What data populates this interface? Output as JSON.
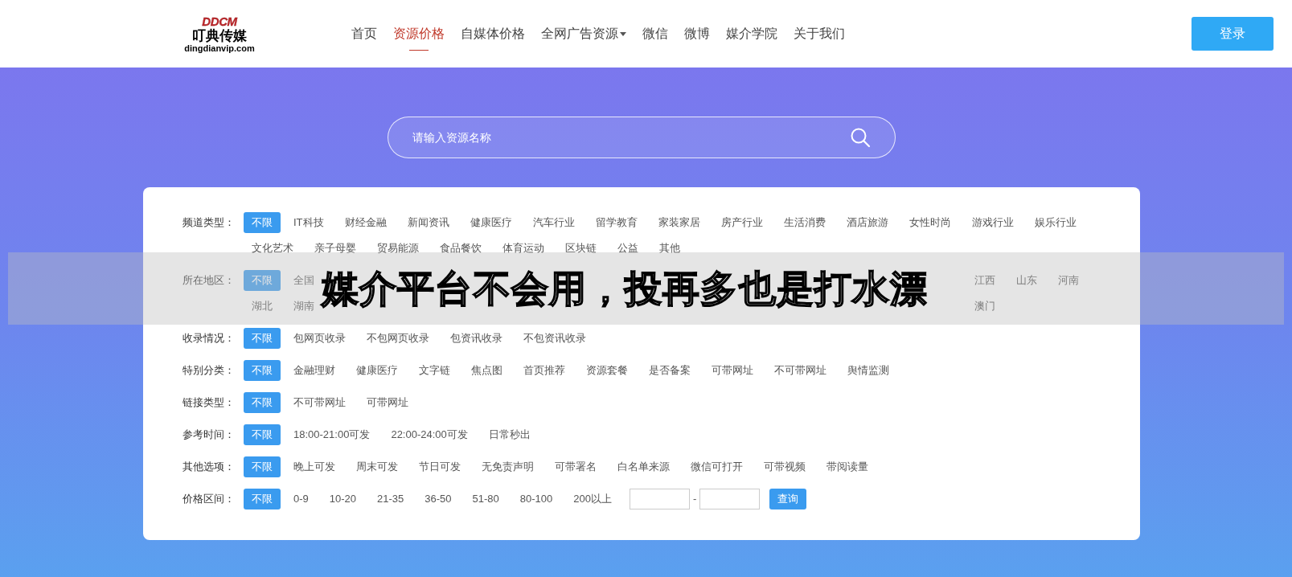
{
  "logo": {
    "name": "叮典传媒",
    "domain": "dingdianvip.com",
    "mark": "DDCM"
  },
  "nav": [
    {
      "label": "首页",
      "selected": false,
      "dropdown": false
    },
    {
      "label": "资源价格",
      "selected": true,
      "dropdown": false
    },
    {
      "label": "自媒体价格",
      "selected": false,
      "dropdown": false
    },
    {
      "label": "全网广告资源",
      "selected": false,
      "dropdown": true
    },
    {
      "label": "微信",
      "selected": false,
      "dropdown": false
    },
    {
      "label": "微博",
      "selected": false,
      "dropdown": false
    },
    {
      "label": "媒介学院",
      "selected": false,
      "dropdown": false
    },
    {
      "label": "关于我们",
      "selected": false,
      "dropdown": false
    }
  ],
  "login_button": "登录",
  "search": {
    "placeholder": "请输入资源名称"
  },
  "filters": [
    {
      "kind": "options",
      "label": "频道类型：",
      "options": [
        {
          "label": "不限",
          "selected": true
        },
        {
          "label": "IT科技",
          "selected": false
        },
        {
          "label": "财经金融",
          "selected": false
        },
        {
          "label": "新闻资讯",
          "selected": false
        },
        {
          "label": "健康医疗",
          "selected": false
        },
        {
          "label": "汽车行业",
          "selected": false
        },
        {
          "label": "留学教育",
          "selected": false
        },
        {
          "label": "家装家居",
          "selected": false
        },
        {
          "label": "房产行业",
          "selected": false
        },
        {
          "label": "生活消费",
          "selected": false
        },
        {
          "label": "酒店旅游",
          "selected": false
        },
        {
          "label": "女性时尚",
          "selected": false
        },
        {
          "label": "游戏行业",
          "selected": false
        },
        {
          "label": "娱乐行业",
          "selected": false
        },
        {
          "label": "文化艺术",
          "selected": false
        },
        {
          "label": "亲子母婴",
          "selected": false
        },
        {
          "label": "贸易能源",
          "selected": false
        },
        {
          "label": "食品餐饮",
          "selected": false
        },
        {
          "label": "体育运动",
          "selected": false
        },
        {
          "label": "区块链",
          "selected": false
        },
        {
          "label": "公益",
          "selected": false
        },
        {
          "label": "其他",
          "selected": false
        }
      ]
    },
    {
      "kind": "region",
      "label": "所在地区：",
      "lines": [
        {
          "left": [
            {
              "label": "不限",
              "selected": true
            },
            {
              "label": "全国",
              "selected": false
            }
          ],
          "right": [
            {
              "label": "江西",
              "selected": false
            },
            {
              "label": "山东",
              "selected": false
            },
            {
              "label": "河南",
              "selected": false
            }
          ]
        },
        {
          "left": [
            {
              "label": "湖北",
              "selected": false
            },
            {
              "label": "湖南",
              "selected": false
            }
          ],
          "right": [
            {
              "label": "澳门",
              "selected": false
            }
          ]
        }
      ]
    },
    {
      "kind": "options",
      "label": "收录情况：",
      "options": [
        {
          "label": "不限",
          "selected": true
        },
        {
          "label": "包网页收录",
          "selected": false
        },
        {
          "label": "不包网页收录",
          "selected": false
        },
        {
          "label": "包资讯收录",
          "selected": false
        },
        {
          "label": "不包资讯收录",
          "selected": false
        }
      ]
    },
    {
      "kind": "options",
      "label": "特别分类：",
      "options": [
        {
          "label": "不限",
          "selected": true
        },
        {
          "label": "金融理财",
          "selected": false
        },
        {
          "label": "健康医疗",
          "selected": false
        },
        {
          "label": "文字链",
          "selected": false
        },
        {
          "label": "焦点图",
          "selected": false
        },
        {
          "label": "首页推荐",
          "selected": false
        },
        {
          "label": "资源套餐",
          "selected": false
        },
        {
          "label": "是否备案",
          "selected": false
        },
        {
          "label": "可带网址",
          "selected": false
        },
        {
          "label": "不可带网址",
          "selected": false
        },
        {
          "label": "舆情监测",
          "selected": false
        }
      ]
    },
    {
      "kind": "options",
      "label": "链接类型：",
      "options": [
        {
          "label": "不限",
          "selected": true
        },
        {
          "label": "不可带网址",
          "selected": false
        },
        {
          "label": "可带网址",
          "selected": false
        }
      ]
    },
    {
      "kind": "options",
      "label": "参考时间：",
      "options": [
        {
          "label": "不限",
          "selected": true
        },
        {
          "label": "18:00-21:00可发",
          "selected": false
        },
        {
          "label": "22:00-24:00可发",
          "selected": false
        },
        {
          "label": "日常秒出",
          "selected": false
        }
      ]
    },
    {
      "kind": "options",
      "label": "其他选项：",
      "options": [
        {
          "label": "不限",
          "selected": true
        },
        {
          "label": "晚上可发",
          "selected": false
        },
        {
          "label": "周末可发",
          "selected": false
        },
        {
          "label": "节日可发",
          "selected": false
        },
        {
          "label": "无免责声明",
          "selected": false
        },
        {
          "label": "可带署名",
          "selected": false
        },
        {
          "label": "白名单来源",
          "selected": false
        },
        {
          "label": "微信可打开",
          "selected": false
        },
        {
          "label": "可带视频",
          "selected": false
        },
        {
          "label": "带阅读量",
          "selected": false
        }
      ]
    },
    {
      "kind": "price",
      "label": "价格区间：",
      "options": [
        {
          "label": "不限",
          "selected": true
        },
        {
          "label": "0-9",
          "selected": false
        },
        {
          "label": "10-20",
          "selected": false
        },
        {
          "label": "21-35",
          "selected": false
        },
        {
          "label": "36-50",
          "selected": false
        },
        {
          "label": "51-80",
          "selected": false
        },
        {
          "label": "80-100",
          "selected": false
        },
        {
          "label": "200以上",
          "selected": false
        }
      ],
      "range_separator": "-",
      "query_button": "查询"
    }
  ],
  "banner": "媒介平台不会用，投再多也是打水漂"
}
